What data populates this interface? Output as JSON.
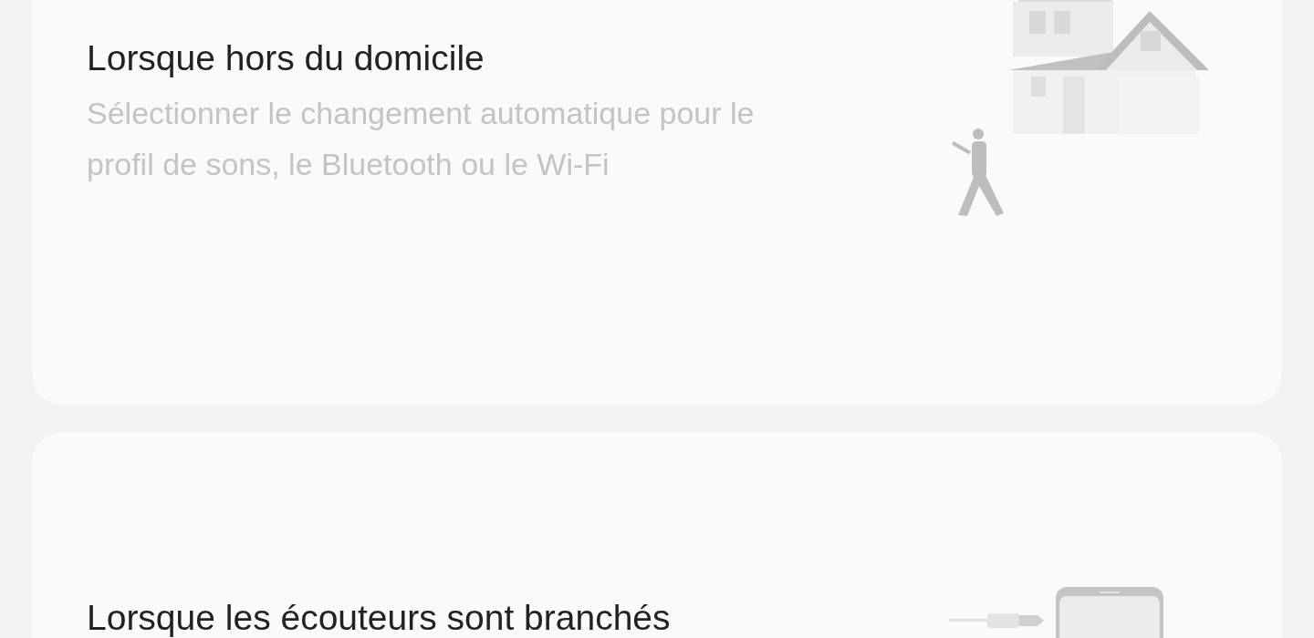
{
  "cards": [
    {
      "title": "Lorsque hors du domicile",
      "description": "Sélectionner le changement automatique pour le profil de sons, le Bluetooth ou le Wi-Fi",
      "illustration": {
        "kind": "house"
      }
    },
    {
      "title": "Lorsque les écouteurs sont branchés",
      "illustration": {
        "kind": "earphones"
      }
    }
  ]
}
